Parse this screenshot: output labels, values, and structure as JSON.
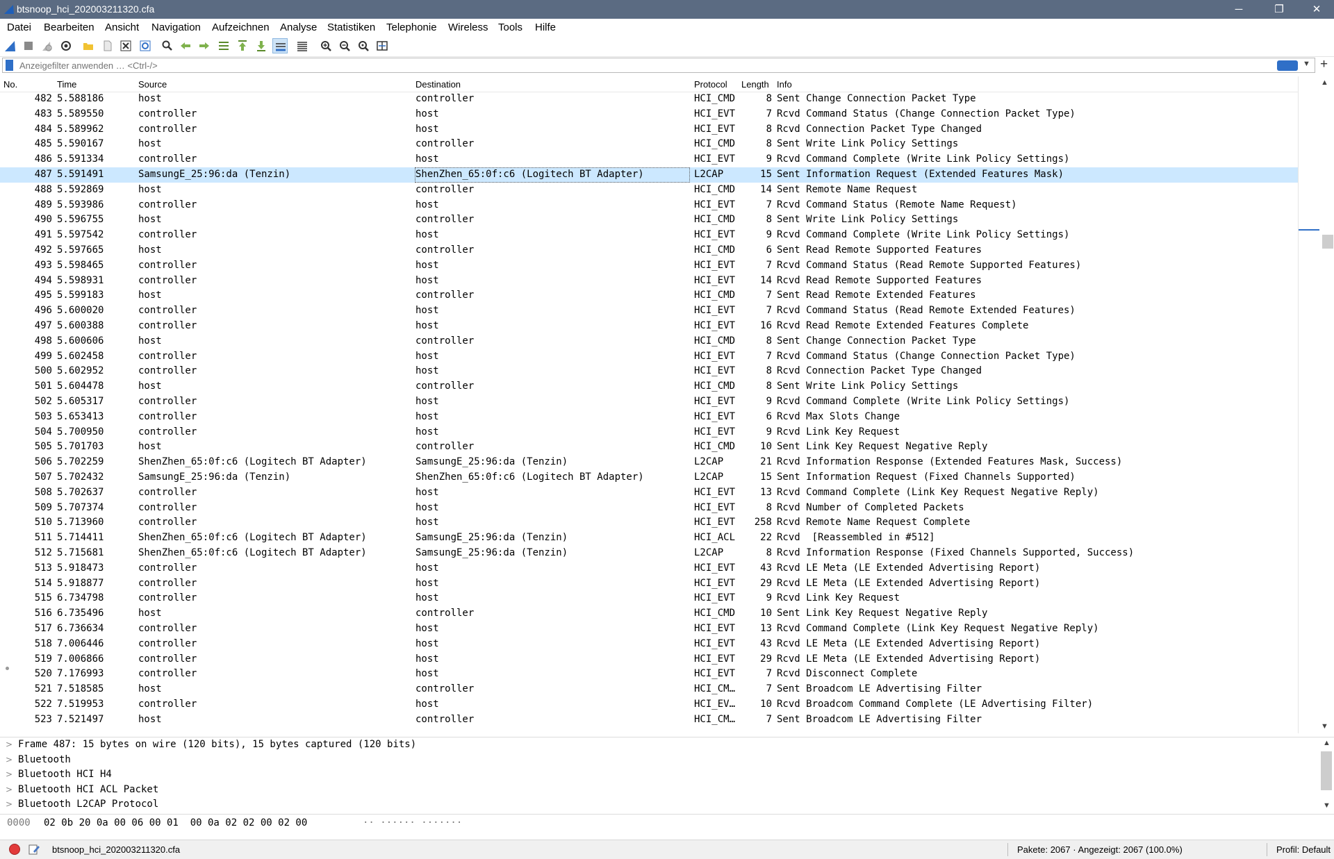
{
  "window": {
    "title": "btsnoop_hci_202003211320.cfa",
    "minimize": "─",
    "maximize": "❐",
    "close": "✕"
  },
  "menu": [
    "Datei",
    "Bearbeiten",
    "Ansicht",
    "Navigation",
    "Aufzeichnen",
    "Analyse",
    "Statistiken",
    "Telephonie",
    "Wireless",
    "Tools",
    "Hilfe"
  ],
  "toolbar_icons": [
    "shark-fin-start-icon",
    "stop-icon",
    "restart-icon",
    "options-gear-icon",
    "open-folder-icon",
    "open-file-icon",
    "close-file-icon",
    "reload-icon",
    "find-icon",
    "back-arrow-icon",
    "forward-arrow-icon",
    "go-to-packet-icon",
    "first-packet-icon",
    "last-packet-icon",
    "autoscroll-icon",
    "colorize-icon",
    "zoom-in-icon",
    "zoom-out-icon",
    "zoom-reset-icon",
    "resize-columns-icon"
  ],
  "filter": {
    "placeholder": "Anzeigefilter anwenden … <Ctrl-/>",
    "value": ""
  },
  "columns": {
    "no": "No.",
    "time": "Time",
    "source": "Source",
    "destination": "Destination",
    "protocol": "Protocol",
    "length": "Length",
    "info": "Info"
  },
  "packets": [
    {
      "no": "482",
      "time": "5.588186",
      "source": "host",
      "destination": "controller",
      "protocol": "HCI_CMD",
      "length": "8",
      "info": "Sent Change Connection Packet Type"
    },
    {
      "no": "483",
      "time": "5.589550",
      "source": "controller",
      "destination": "host",
      "protocol": "HCI_EVT",
      "length": "7",
      "info": "Rcvd Command Status (Change Connection Packet Type)"
    },
    {
      "no": "484",
      "time": "5.589962",
      "source": "controller",
      "destination": "host",
      "protocol": "HCI_EVT",
      "length": "8",
      "info": "Rcvd Connection Packet Type Changed"
    },
    {
      "no": "485",
      "time": "5.590167",
      "source": "host",
      "destination": "controller",
      "protocol": "HCI_CMD",
      "length": "8",
      "info": "Sent Write Link Policy Settings"
    },
    {
      "no": "486",
      "time": "5.591334",
      "source": "controller",
      "destination": "host",
      "protocol": "HCI_EVT",
      "length": "9",
      "info": "Rcvd Command Complete (Write Link Policy Settings)"
    },
    {
      "no": "487",
      "time": "5.591491",
      "source": "SamsungE_25:96:da (Tenzin)",
      "destination": "ShenZhen_65:0f:c6 (Logitech BT Adapter)",
      "protocol": "L2CAP",
      "length": "15",
      "info": "Sent Information Request (Extended Features Mask)",
      "selected": true
    },
    {
      "no": "488",
      "time": "5.592869",
      "source": "host",
      "destination": "controller",
      "protocol": "HCI_CMD",
      "length": "14",
      "info": "Sent Remote Name Request"
    },
    {
      "no": "489",
      "time": "5.593986",
      "source": "controller",
      "destination": "host",
      "protocol": "HCI_EVT",
      "length": "7",
      "info": "Rcvd Command Status (Remote Name Request)"
    },
    {
      "no": "490",
      "time": "5.596755",
      "source": "host",
      "destination": "controller",
      "protocol": "HCI_CMD",
      "length": "8",
      "info": "Sent Write Link Policy Settings"
    },
    {
      "no": "491",
      "time": "5.597542",
      "source": "controller",
      "destination": "host",
      "protocol": "HCI_EVT",
      "length": "9",
      "info": "Rcvd Command Complete (Write Link Policy Settings)"
    },
    {
      "no": "492",
      "time": "5.597665",
      "source": "host",
      "destination": "controller",
      "protocol": "HCI_CMD",
      "length": "6",
      "info": "Sent Read Remote Supported Features"
    },
    {
      "no": "493",
      "time": "5.598465",
      "source": "controller",
      "destination": "host",
      "protocol": "HCI_EVT",
      "length": "7",
      "info": "Rcvd Command Status (Read Remote Supported Features)"
    },
    {
      "no": "494",
      "time": "5.598931",
      "source": "controller",
      "destination": "host",
      "protocol": "HCI_EVT",
      "length": "14",
      "info": "Rcvd Read Remote Supported Features"
    },
    {
      "no": "495",
      "time": "5.599183",
      "source": "host",
      "destination": "controller",
      "protocol": "HCI_CMD",
      "length": "7",
      "info": "Sent Read Remote Extended Features"
    },
    {
      "no": "496",
      "time": "5.600020",
      "source": "controller",
      "destination": "host",
      "protocol": "HCI_EVT",
      "length": "7",
      "info": "Rcvd Command Status (Read Remote Extended Features)"
    },
    {
      "no": "497",
      "time": "5.600388",
      "source": "controller",
      "destination": "host",
      "protocol": "HCI_EVT",
      "length": "16",
      "info": "Rcvd Read Remote Extended Features Complete"
    },
    {
      "no": "498",
      "time": "5.600606",
      "source": "host",
      "destination": "controller",
      "protocol": "HCI_CMD",
      "length": "8",
      "info": "Sent Change Connection Packet Type"
    },
    {
      "no": "499",
      "time": "5.602458",
      "source": "controller",
      "destination": "host",
      "protocol": "HCI_EVT",
      "length": "7",
      "info": "Rcvd Command Status (Change Connection Packet Type)"
    },
    {
      "no": "500",
      "time": "5.602952",
      "source": "controller",
      "destination": "host",
      "protocol": "HCI_EVT",
      "length": "8",
      "info": "Rcvd Connection Packet Type Changed"
    },
    {
      "no": "501",
      "time": "5.604478",
      "source": "host",
      "destination": "controller",
      "protocol": "HCI_CMD",
      "length": "8",
      "info": "Sent Write Link Policy Settings"
    },
    {
      "no": "502",
      "time": "5.605317",
      "source": "controller",
      "destination": "host",
      "protocol": "HCI_EVT",
      "length": "9",
      "info": "Rcvd Command Complete (Write Link Policy Settings)"
    },
    {
      "no": "503",
      "time": "5.653413",
      "source": "controller",
      "destination": "host",
      "protocol": "HCI_EVT",
      "length": "6",
      "info": "Rcvd Max Slots Change"
    },
    {
      "no": "504",
      "time": "5.700950",
      "source": "controller",
      "destination": "host",
      "protocol": "HCI_EVT",
      "length": "9",
      "info": "Rcvd Link Key Request"
    },
    {
      "no": "505",
      "time": "5.701703",
      "source": "host",
      "destination": "controller",
      "protocol": "HCI_CMD",
      "length": "10",
      "info": "Sent Link Key Request Negative Reply"
    },
    {
      "no": "506",
      "time": "5.702259",
      "source": "ShenZhen_65:0f:c6 (Logitech BT Adapter)",
      "destination": "SamsungE_25:96:da (Tenzin)",
      "protocol": "L2CAP",
      "length": "21",
      "info": "Rcvd Information Response (Extended Features Mask, Success)"
    },
    {
      "no": "507",
      "time": "5.702432",
      "source": "SamsungE_25:96:da (Tenzin)",
      "destination": "ShenZhen_65:0f:c6 (Logitech BT Adapter)",
      "protocol": "L2CAP",
      "length": "15",
      "info": "Sent Information Request (Fixed Channels Supported)"
    },
    {
      "no": "508",
      "time": "5.702637",
      "source": "controller",
      "destination": "host",
      "protocol": "HCI_EVT",
      "length": "13",
      "info": "Rcvd Command Complete (Link Key Request Negative Reply)"
    },
    {
      "no": "509",
      "time": "5.707374",
      "source": "controller",
      "destination": "host",
      "protocol": "HCI_EVT",
      "length": "8",
      "info": "Rcvd Number of Completed Packets"
    },
    {
      "no": "510",
      "time": "5.713960",
      "source": "controller",
      "destination": "host",
      "protocol": "HCI_EVT",
      "length": "258",
      "info": "Rcvd Remote Name Request Complete"
    },
    {
      "no": "511",
      "time": "5.714411",
      "source": "ShenZhen_65:0f:c6 (Logitech BT Adapter)",
      "destination": "SamsungE_25:96:da (Tenzin)",
      "protocol": "HCI_ACL",
      "length": "22",
      "info": "Rcvd  [Reassembled in #512]"
    },
    {
      "no": "512",
      "time": "5.715681",
      "source": "ShenZhen_65:0f:c6 (Logitech BT Adapter)",
      "destination": "SamsungE_25:96:da (Tenzin)",
      "protocol": "L2CAP",
      "length": "8",
      "info": "Rcvd Information Response (Fixed Channels Supported, Success)"
    },
    {
      "no": "513",
      "time": "5.918473",
      "source": "controller",
      "destination": "host",
      "protocol": "HCI_EVT",
      "length": "43",
      "info": "Rcvd LE Meta (LE Extended Advertising Report)"
    },
    {
      "no": "514",
      "time": "5.918877",
      "source": "controller",
      "destination": "host",
      "protocol": "HCI_EVT",
      "length": "29",
      "info": "Rcvd LE Meta (LE Extended Advertising Report)"
    },
    {
      "no": "515",
      "time": "6.734798",
      "source": "controller",
      "destination": "host",
      "protocol": "HCI_EVT",
      "length": "9",
      "info": "Rcvd Link Key Request"
    },
    {
      "no": "516",
      "time": "6.735496",
      "source": "host",
      "destination": "controller",
      "protocol": "HCI_CMD",
      "length": "10",
      "info": "Sent Link Key Request Negative Reply"
    },
    {
      "no": "517",
      "time": "6.736634",
      "source": "controller",
      "destination": "host",
      "protocol": "HCI_EVT",
      "length": "13",
      "info": "Rcvd Command Complete (Link Key Request Negative Reply)"
    },
    {
      "no": "518",
      "time": "7.006446",
      "source": "controller",
      "destination": "host",
      "protocol": "HCI_EVT",
      "length": "43",
      "info": "Rcvd LE Meta (LE Extended Advertising Report)"
    },
    {
      "no": "519",
      "time": "7.006866",
      "source": "controller",
      "destination": "host",
      "protocol": "HCI_EVT",
      "length": "29",
      "info": "Rcvd LE Meta (LE Extended Advertising Report)"
    },
    {
      "no": "520",
      "time": "7.176993",
      "source": "controller",
      "destination": "host",
      "protocol": "HCI_EVT",
      "length": "7",
      "info": "Rcvd Disconnect Complete",
      "marked": true
    },
    {
      "no": "521",
      "time": "7.518585",
      "source": "host",
      "destination": "controller",
      "protocol": "HCI_CM…",
      "length": "7",
      "info": "Sent Broadcom LE Advertising Filter"
    },
    {
      "no": "522",
      "time": "7.519953",
      "source": "controller",
      "destination": "host",
      "protocol": "HCI_EV…",
      "length": "10",
      "info": "Rcvd Broadcom Command Complete (LE Advertising Filter)"
    },
    {
      "no": "523",
      "time": "7.521497",
      "source": "host",
      "destination": "controller",
      "protocol": "HCI_CM…",
      "length": "7",
      "info": "Sent Broadcom LE Advertising Filter"
    }
  ],
  "details": [
    "Frame 487: 15 bytes on wire (120 bits), 15 bytes captured (120 bits)",
    "Bluetooth",
    "Bluetooth HCI H4",
    "Bluetooth HCI ACL Packet",
    "Bluetooth L2CAP Protocol"
  ],
  "bytes": {
    "offset": "0000",
    "hex": "02 0b 20 0a 00 06 00 01  00 0a 02 02 00 02 00",
    "ascii": "·· ······ ·······"
  },
  "status": {
    "file": "btsnoop_hci_202003211320.cfa",
    "packets": "Pakete: 2067 · Angezeigt: 2067 (100.0%)",
    "profile": "Profil: Default"
  },
  "colors": {
    "titlebar": "#5b6b82",
    "selection": "#cce8ff",
    "accent": "#2f6fc7"
  }
}
